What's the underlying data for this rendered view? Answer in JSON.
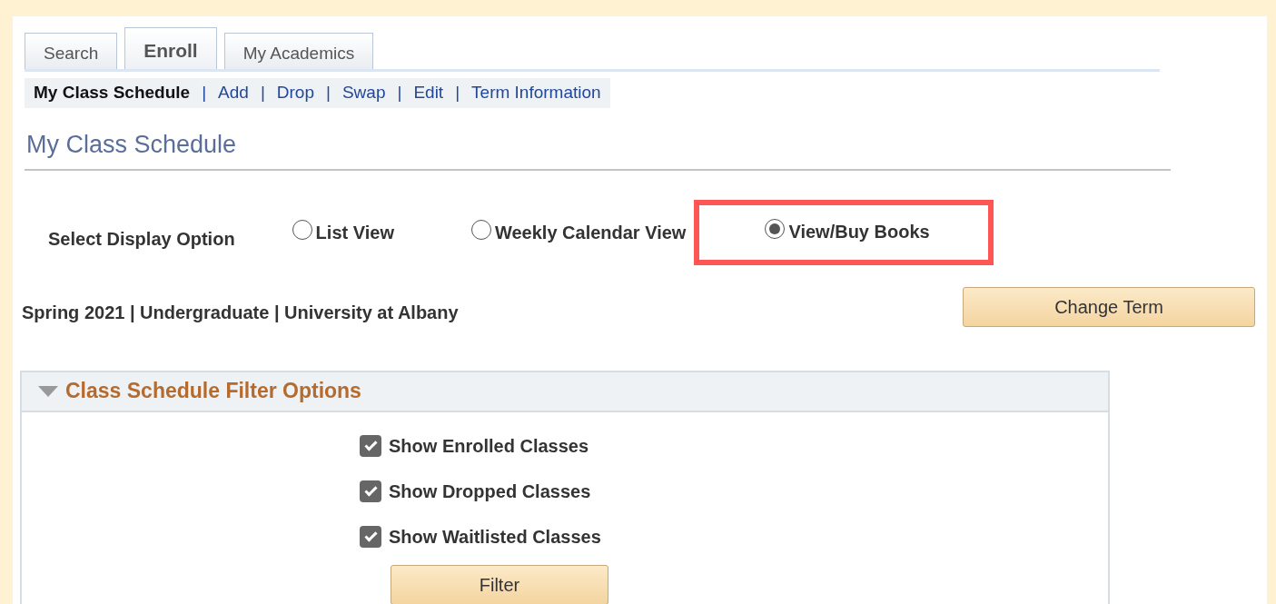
{
  "tabs": [
    {
      "label": "Search",
      "selected": false
    },
    {
      "label": "Enroll",
      "selected": true
    },
    {
      "label": "My Academics",
      "selected": false
    }
  ],
  "subnav": [
    {
      "label": "My Class Schedule",
      "selected": true
    },
    {
      "label": "Add",
      "selected": false
    },
    {
      "label": "Drop",
      "selected": false
    },
    {
      "label": "Swap",
      "selected": false
    },
    {
      "label": "Edit",
      "selected": false
    },
    {
      "label": "Term Information",
      "selected": false
    }
  ],
  "separator": "|",
  "page_title": "My Class Schedule",
  "display_option": {
    "label": "Select Display Option",
    "options": [
      {
        "label": "List View",
        "selected": false,
        "highlighted": false
      },
      {
        "label": "Weekly Calendar View",
        "selected": false,
        "highlighted": false
      },
      {
        "label": "View/Buy Books",
        "selected": true,
        "highlighted": true
      }
    ]
  },
  "term": "Spring 2021 | Undergraduate | University at Albany",
  "change_term_button": "Change Term",
  "filter_panel": {
    "title": "Class Schedule Filter Options",
    "expanded": true,
    "checkboxes": [
      {
        "label": "Show Enrolled Classes",
        "checked": true
      },
      {
        "label": "Show Dropped Classes",
        "checked": true
      },
      {
        "label": "Show Waitlisted Classes",
        "checked": true
      }
    ],
    "button": "Filter"
  }
}
